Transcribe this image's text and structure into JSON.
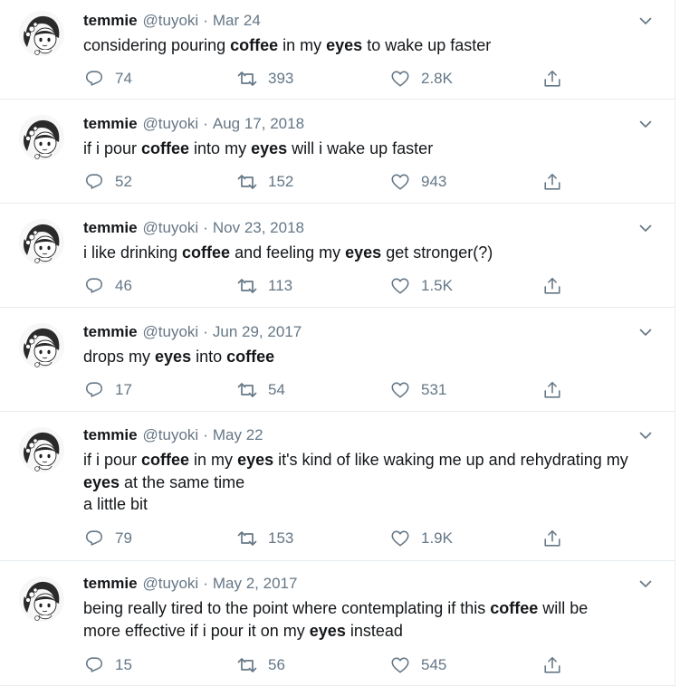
{
  "tweets": [
    {
      "name": "temmie",
      "handle": "@tuyoki",
      "separator": "·",
      "date": "Mar 24",
      "lines": [
        [
          {
            "t": "considering pouring ",
            "b": false
          },
          {
            "t": "coffee",
            "b": true
          },
          {
            "t": " in my ",
            "b": false
          },
          {
            "t": "eyes",
            "b": true
          },
          {
            "t": " to wake up faster",
            "b": false
          }
        ]
      ],
      "replies": "74",
      "retweets": "393",
      "likes": "2.8K"
    },
    {
      "name": "temmie",
      "handle": "@tuyoki",
      "separator": "·",
      "date": "Aug 17, 2018",
      "lines": [
        [
          {
            "t": "if i pour ",
            "b": false
          },
          {
            "t": "coffee",
            "b": true
          },
          {
            "t": " into my ",
            "b": false
          },
          {
            "t": "eyes",
            "b": true
          },
          {
            "t": " will i wake up faster",
            "b": false
          }
        ]
      ],
      "replies": "52",
      "retweets": "152",
      "likes": "943"
    },
    {
      "name": "temmie",
      "handle": "@tuyoki",
      "separator": "·",
      "date": "Nov 23, 2018",
      "lines": [
        [
          {
            "t": "i like drinking ",
            "b": false
          },
          {
            "t": "coffee",
            "b": true
          },
          {
            "t": " and feeling my ",
            "b": false
          },
          {
            "t": "eyes",
            "b": true
          },
          {
            "t": " get stronger(?)",
            "b": false
          }
        ]
      ],
      "replies": "46",
      "retweets": "113",
      "likes": "1.5K"
    },
    {
      "name": "temmie",
      "handle": "@tuyoki",
      "separator": "·",
      "date": "Jun 29, 2017",
      "lines": [
        [
          {
            "t": "drops my ",
            "b": false
          },
          {
            "t": "eyes",
            "b": true
          },
          {
            "t": " into ",
            "b": false
          },
          {
            "t": "coffee",
            "b": true
          }
        ]
      ],
      "replies": "17",
      "retweets": "54",
      "likes": "531"
    },
    {
      "name": "temmie",
      "handle": "@tuyoki",
      "separator": "·",
      "date": "May 22",
      "lines": [
        [
          {
            "t": "if i pour ",
            "b": false
          },
          {
            "t": "coffee",
            "b": true
          },
          {
            "t": " in my ",
            "b": false
          },
          {
            "t": "eyes",
            "b": true
          },
          {
            "t": " it's kind of like waking me up and rehydrating my",
            "b": false
          }
        ],
        [
          {
            "t": "eyes",
            "b": true
          },
          {
            "t": " at the same time",
            "b": false
          }
        ],
        [
          {
            "t": "a little bit",
            "b": false
          }
        ]
      ],
      "replies": "79",
      "retweets": "153",
      "likes": "1.9K"
    },
    {
      "name": "temmie",
      "handle": "@tuyoki",
      "separator": "·",
      "date": "May 2, 2017",
      "lines": [
        [
          {
            "t": "being really tired to the point where contemplating if this ",
            "b": false
          },
          {
            "t": "coffee",
            "b": true
          },
          {
            "t": " will be",
            "b": false
          }
        ],
        [
          {
            "t": "more effective if i pour it on my ",
            "b": false
          },
          {
            "t": "eyes",
            "b": true
          },
          {
            "t": " instead",
            "b": false
          }
        ]
      ],
      "replies": "15",
      "retweets": "56",
      "likes": "545"
    }
  ],
  "icons": {
    "reply": "reply-icon",
    "retweet": "retweet-icon",
    "like": "heart-icon",
    "share": "share-icon",
    "menu": "chevron-down-icon"
  },
  "colors": {
    "text": "#14171a",
    "secondary": "#657786",
    "border": "#e6ecf0"
  }
}
